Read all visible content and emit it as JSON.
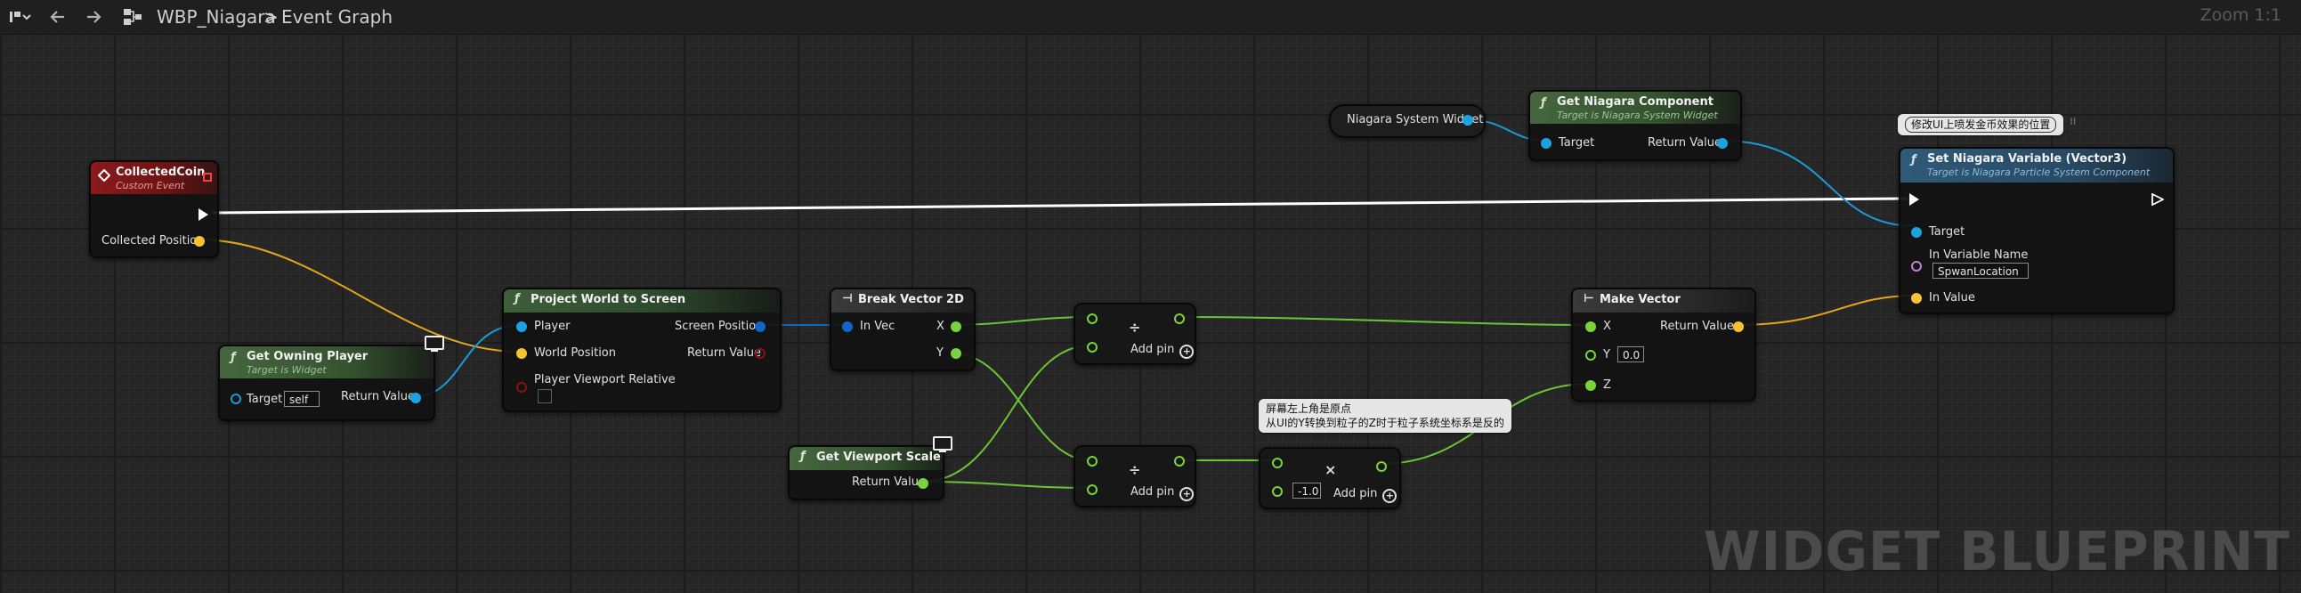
{
  "toolbar": {
    "asset_name": "WBP_Niagara",
    "separator": ">",
    "graph_name": "Event Graph",
    "zoom": "Zoom 1:1"
  },
  "watermark": "WIDGET BLUEPRINT",
  "comments": {
    "set_variable": "修改UI上喷发金币效果的位置",
    "screen_origin_line1": "屏幕左上角是原点",
    "screen_origin_line2": "从UI的Y转换到粒子的Z时于粒子系统坐标系是反的"
  },
  "nodes": {
    "collected_coin": {
      "title": "CollectedCoin",
      "subtitle": "Custom Event",
      "pin_position": "Collected Position"
    },
    "get_owning_player": {
      "title": "Get Owning Player",
      "subtitle": "Target is Widget",
      "pin_target": "Target",
      "target_value": "self",
      "pin_return": "Return Value"
    },
    "project_world": {
      "title": "Project World to Screen",
      "pin_player": "Player",
      "pin_world": "World Position",
      "pin_viewport": "Player Viewport Relative",
      "pin_screen": "Screen Position",
      "pin_return": "Return Value"
    },
    "break_vector": {
      "title": "Break Vector 2D",
      "pin_in": "In Vec",
      "pin_x": "X",
      "pin_y": "Y"
    },
    "get_viewport_scale": {
      "title": "Get Viewport Scale",
      "pin_return": "Return Value"
    },
    "divide_top": {
      "symbol": "÷",
      "add_pin": "Add pin"
    },
    "divide_bottom": {
      "symbol": "÷",
      "add_pin": "Add pin"
    },
    "multiply": {
      "symbol": "×",
      "value": "-1.0",
      "add_pin": "Add pin"
    },
    "make_vector": {
      "title": "Make Vector",
      "pin_x": "X",
      "pin_y": "Y",
      "y_value": "0.0",
      "pin_z": "Z",
      "pin_return": "Return Value"
    },
    "niagara_widget": {
      "title": "Niagara System Widget"
    },
    "get_niagara_component": {
      "title": "Get Niagara Component",
      "subtitle": "Target is Niagara System Widget",
      "pin_target": "Target",
      "pin_return": "Return Value"
    },
    "set_niagara_variable": {
      "title": "Set Niagara Variable (Vector3)",
      "subtitle": "Target is Niagara Particle System Component",
      "pin_target": "Target",
      "pin_name": "In Variable Name",
      "name_value": "SpwanLocation",
      "pin_value": "In Value"
    }
  },
  "colors": {
    "vector_pin": "#f7c330",
    "object_pin": "#1aa3e0",
    "float_pin": "#7ad33d",
    "struct2d_pin": "#1466c6",
    "bool_pin": "#8a1212",
    "name_pin": "#c27fd6",
    "exec": "#ffffff"
  }
}
